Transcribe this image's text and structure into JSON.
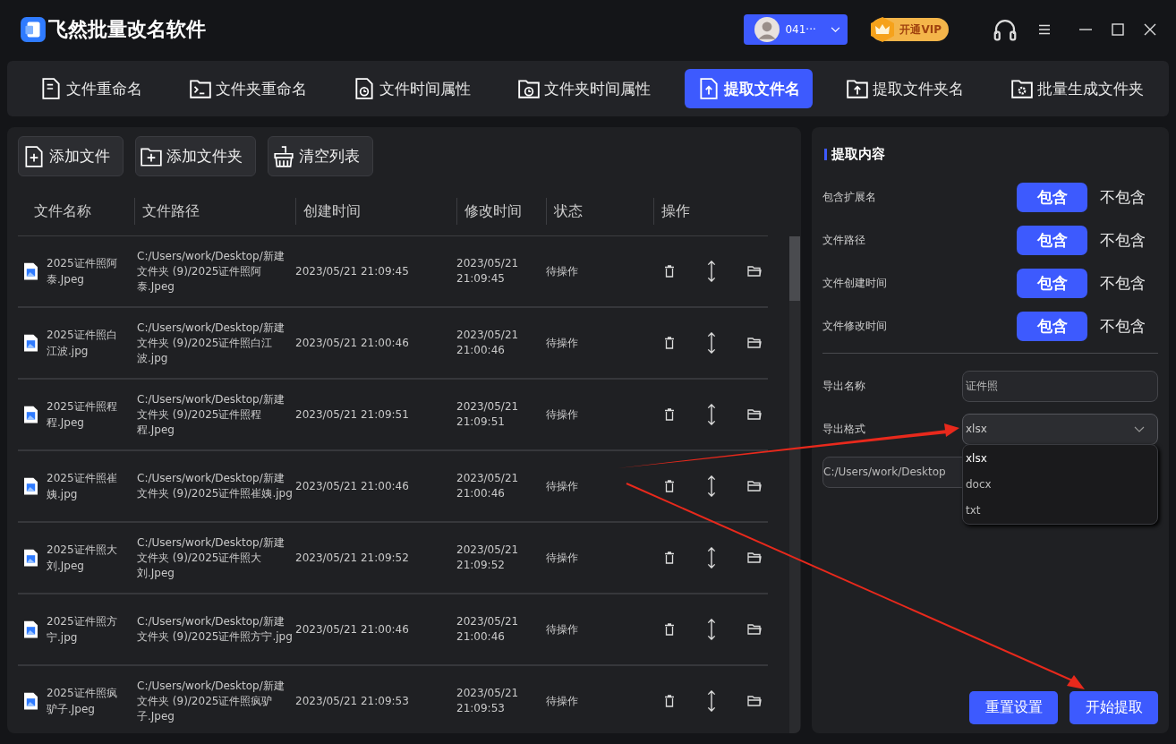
{
  "app": {
    "title": "飞然批量改名软件",
    "user": "041···",
    "vip": "开通VIP"
  },
  "tabs": [
    {
      "label": "文件重命名",
      "kind": "file",
      "selected": false
    },
    {
      "label": "文件夹重命名",
      "kind": "terminal",
      "selected": false
    },
    {
      "label": "文件时间属性",
      "kind": "file-clock",
      "selected": false
    },
    {
      "label": "文件夹时间属性",
      "kind": "folder-clock",
      "selected": false
    },
    {
      "label": "提取文件名",
      "kind": "file-up",
      "selected": true
    },
    {
      "label": "提取文件夹名",
      "kind": "folder-up",
      "selected": false
    },
    {
      "label": "批量生成文件夹",
      "kind": "folder-gear",
      "selected": false
    }
  ],
  "toolbar": [
    {
      "label": "添加文件",
      "kind": "file"
    },
    {
      "label": "添加文件夹",
      "kind": "folder"
    },
    {
      "label": "清空列表",
      "kind": "clear"
    }
  ],
  "table": {
    "columns": [
      "文件名称",
      "文件路径",
      "创建时间",
      "修改时间",
      "状态",
      "操作"
    ],
    "rows": [
      {
        "name": "2025证件照阿泰.Jpeg",
        "path": "C:/Users/work/Desktop/新建文件夹 (9)/2025证件照阿泰.Jpeg",
        "created": "2023/05/21 21:09:45",
        "modified": "2023/05/21 21:09:45",
        "status": "待操作"
      },
      {
        "name": "2025证件照白江波.jpg",
        "path": "C:/Users/work/Desktop/新建文件夹 (9)/2025证件照白江波.jpg",
        "created": "2023/05/21 21:00:46",
        "modified": "2023/05/21 21:00:46",
        "status": "待操作"
      },
      {
        "name": "2025证件照程程.Jpeg",
        "path": "C:/Users/work/Desktop/新建文件夹 (9)/2025证件照程程.Jpeg",
        "created": "2023/05/21 21:09:51",
        "modified": "2023/05/21 21:09:51",
        "status": "待操作"
      },
      {
        "name": "2025证件照崔姨.jpg",
        "path": "C:/Users/work/Desktop/新建文件夹 (9)/2025证件照崔姨.jpg",
        "created": "2023/05/21 21:00:46",
        "modified": "2023/05/21 21:00:46",
        "status": "待操作"
      },
      {
        "name": "2025证件照大刘.Jpeg",
        "path": "C:/Users/work/Desktop/新建文件夹 (9)/2025证件照大刘.Jpeg",
        "created": "2023/05/21 21:09:52",
        "modified": "2023/05/21 21:09:52",
        "status": "待操作"
      },
      {
        "name": "2025证件照方宁.jpg",
        "path": "C:/Users/work/Desktop/新建文件夹 (9)/2025证件照方宁.jpg",
        "created": "2023/05/21 21:00:46",
        "modified": "2023/05/21 21:00:46",
        "status": "待操作"
      },
      {
        "name": "2025证件照疯驴子.Jpeg",
        "path": "C:/Users/work/Desktop/新建文件夹 (9)/2025证件照疯驴子.Jpeg",
        "created": "2023/05/21 21:09:53",
        "modified": "2023/05/21 21:09:53",
        "status": "待操作"
      }
    ]
  },
  "panel": {
    "title": "提取内容",
    "options": [
      {
        "label": "包含扩展名",
        "choices": [
          {
            "label": "包含",
            "selected": true
          },
          {
            "label": "不包含",
            "selected": false
          }
        ]
      },
      {
        "label": "文件路径",
        "choices": [
          {
            "label": "包含",
            "selected": true
          },
          {
            "label": "不包含",
            "selected": false
          }
        ]
      },
      {
        "label": "文件创建时间",
        "choices": [
          {
            "label": "包含",
            "selected": true
          },
          {
            "label": "不包含",
            "selected": false
          }
        ]
      },
      {
        "label": "文件修改时间",
        "choices": [
          {
            "label": "包含",
            "selected": true
          },
          {
            "label": "不包含",
            "selected": false
          }
        ]
      }
    ],
    "export_name": {
      "label": "导出名称",
      "value": "证件照"
    },
    "export_format": {
      "label": "导出格式",
      "value": "xlsx",
      "expanded": true,
      "options": [
        {
          "label": "xlsx",
          "selected": true
        },
        {
          "label": "docx",
          "selected": false
        },
        {
          "label": "txt",
          "selected": false
        }
      ]
    },
    "export_path": {
      "value": "C:/Users/work/Desktop"
    },
    "buttons": [
      "重置设置",
      "开始提取"
    ]
  }
}
